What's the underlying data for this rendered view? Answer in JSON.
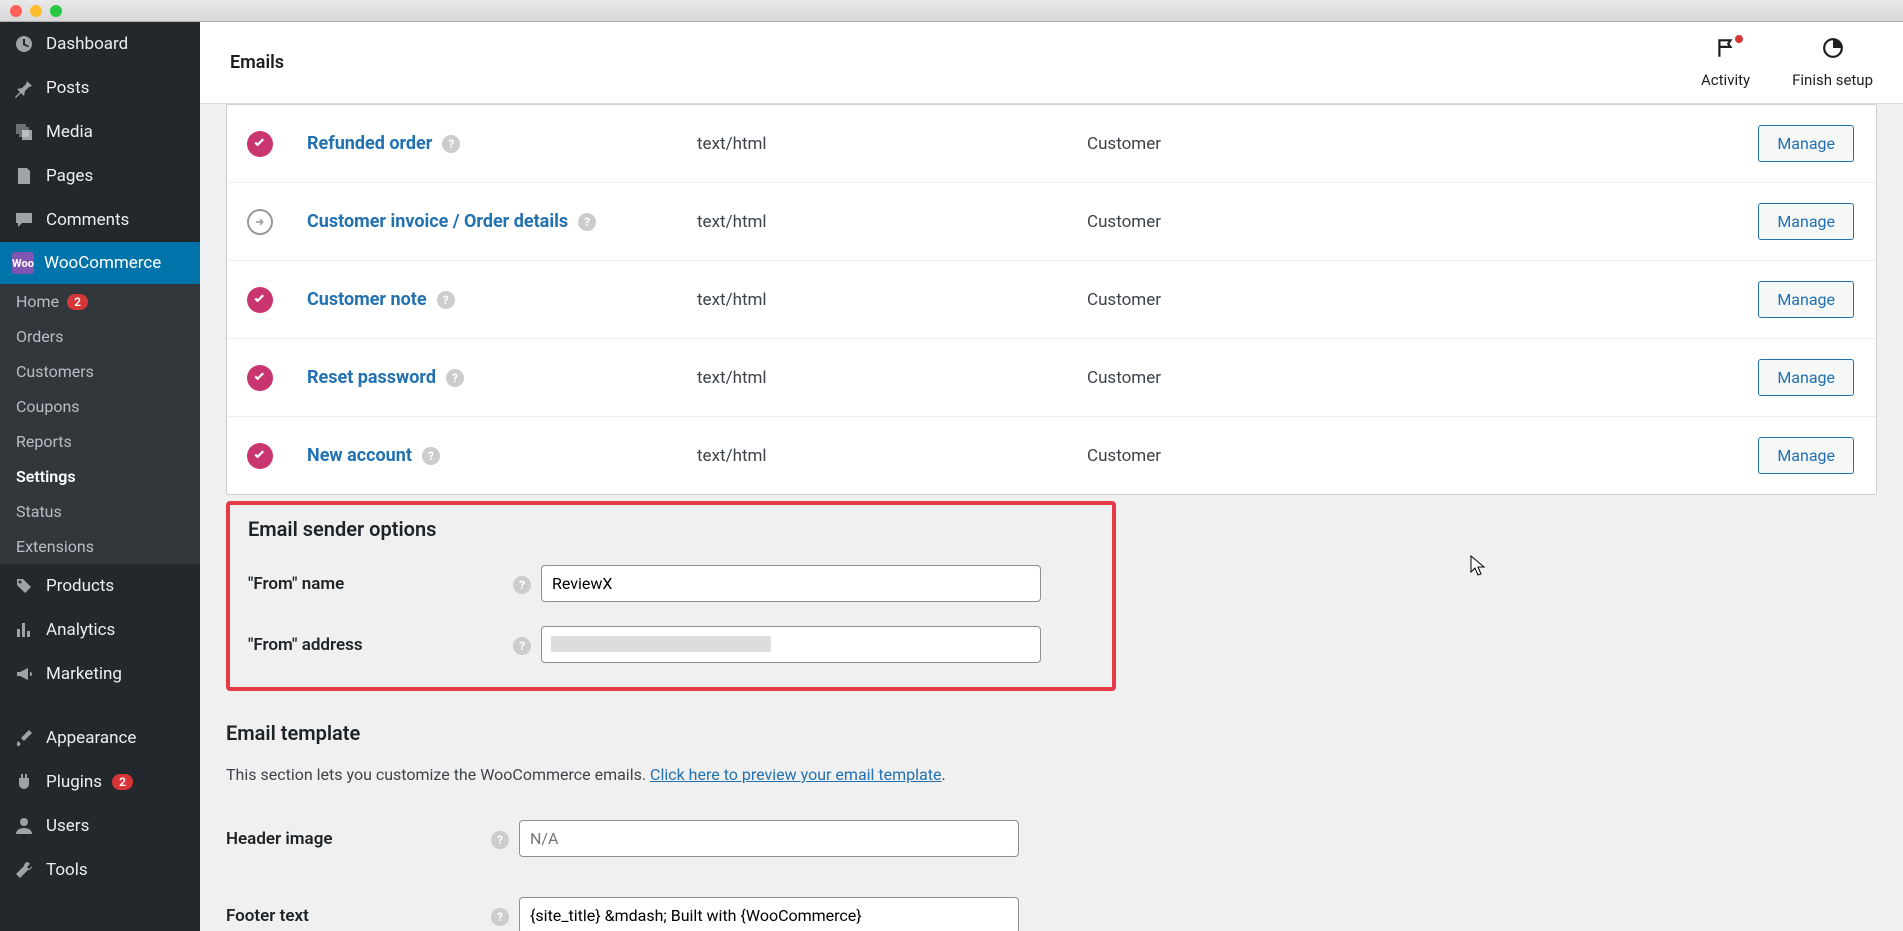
{
  "sidebar": {
    "dashboard": "Dashboard",
    "posts": "Posts",
    "media": "Media",
    "pages": "Pages",
    "comments": "Comments",
    "woocommerce": "WooCommerce",
    "woo_icon": "Woo",
    "sub": {
      "home": "Home",
      "home_badge": "2",
      "orders": "Orders",
      "customers": "Customers",
      "coupons": "Coupons",
      "reports": "Reports",
      "settings": "Settings",
      "status": "Status",
      "extensions": "Extensions"
    },
    "products": "Products",
    "analytics": "Analytics",
    "marketing": "Marketing",
    "appearance": "Appearance",
    "plugins": "Plugins",
    "plugins_badge": "2",
    "users": "Users",
    "tools": "Tools"
  },
  "topbar": {
    "title": "Emails",
    "activity": "Activity",
    "finish_setup": "Finish setup"
  },
  "emails": [
    {
      "status": "on",
      "name": "Refunded order",
      "ct": "text/html",
      "rcpt": "Customer",
      "btn": "Manage"
    },
    {
      "status": "manual",
      "name": "Customer invoice / Order details",
      "ct": "text/html",
      "rcpt": "Customer",
      "btn": "Manage"
    },
    {
      "status": "on",
      "name": "Customer note",
      "ct": "text/html",
      "rcpt": "Customer",
      "btn": "Manage"
    },
    {
      "status": "on",
      "name": "Reset password",
      "ct": "text/html",
      "rcpt": "Customer",
      "btn": "Manage"
    },
    {
      "status": "on",
      "name": "New account",
      "ct": "text/html",
      "rcpt": "Customer",
      "btn": "Manage"
    }
  ],
  "sender": {
    "heading": "Email sender options",
    "from_name_label": "\"From\" name",
    "from_name_value": "ReviewX",
    "from_address_label": "\"From\" address",
    "from_address_value": ""
  },
  "template": {
    "heading": "Email template",
    "desc_prefix": "This section lets you customize the WooCommerce emails. ",
    "desc_link": "Click here to preview your email template",
    "header_image_label": "Header image",
    "header_image_placeholder": "N/A",
    "footer_text_label": "Footer text",
    "footer_text_value": "{site_title} &mdash; Built with {WooCommerce}"
  }
}
